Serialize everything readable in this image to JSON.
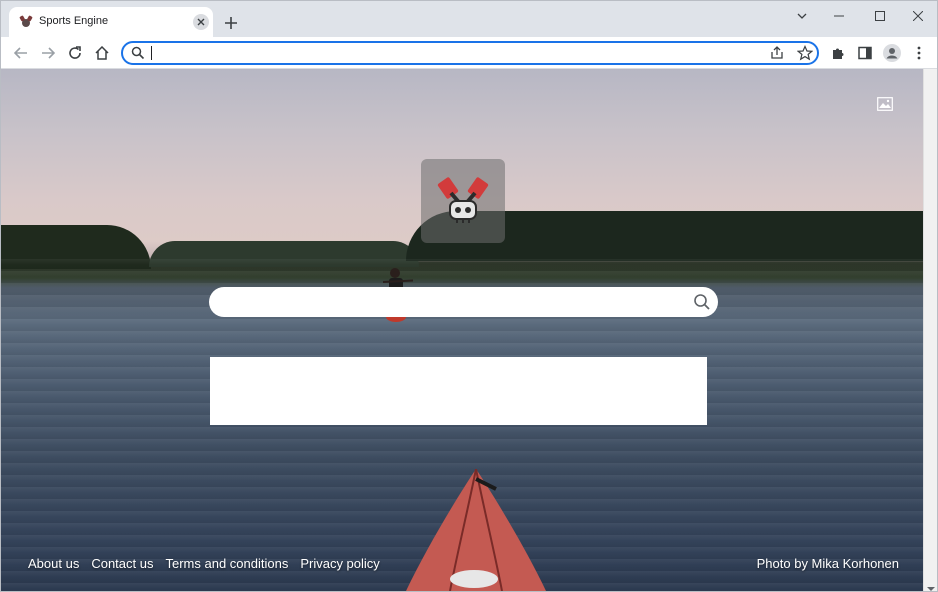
{
  "tab": {
    "title": "Sports Engine",
    "favicon": "engine-favicon-icon"
  },
  "toolbar": {
    "omnibox_value": "",
    "omnibox_placeholder": ""
  },
  "page": {
    "search_placeholder": "",
    "search_value": "",
    "footer_links": [
      "About us",
      "Contact us",
      "Terms and conditions",
      "Privacy policy"
    ],
    "photo_credit": "Photo by Mika Korhonen"
  },
  "colors": {
    "accent": "#1a73e8",
    "tabstrip": "#dfe3e9"
  }
}
